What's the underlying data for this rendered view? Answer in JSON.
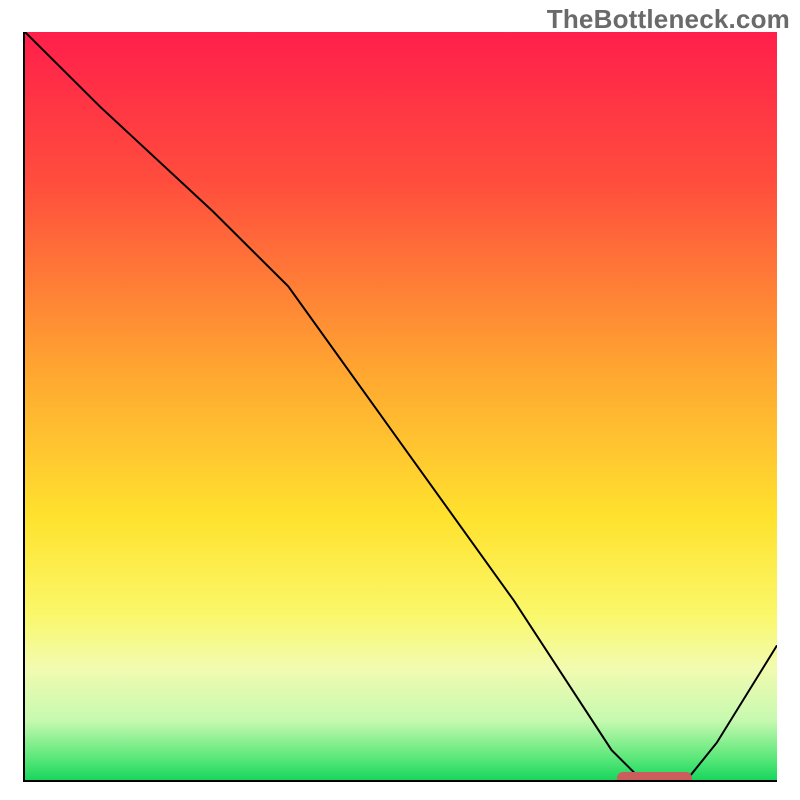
{
  "watermark": "TheBottleneck.com",
  "chart_data": {
    "type": "line",
    "title": "",
    "xlabel": "",
    "ylabel": "",
    "xlim": [
      0,
      100
    ],
    "ylim": [
      0,
      100
    ],
    "x": [
      0,
      10,
      25,
      35,
      50,
      65,
      78,
      82,
      88,
      92,
      100
    ],
    "values": [
      100,
      90,
      76,
      66,
      45,
      24,
      4,
      0,
      0,
      5,
      18
    ],
    "gradient_stops": [
      {
        "offset": 0,
        "color": "#ff1f4b"
      },
      {
        "offset": 20,
        "color": "#ff4d3d"
      },
      {
        "offset": 45,
        "color": "#ffa531"
      },
      {
        "offset": 65,
        "color": "#ffe22e"
      },
      {
        "offset": 78,
        "color": "#faf86b"
      },
      {
        "offset": 85,
        "color": "#f2fbb0"
      },
      {
        "offset": 92,
        "color": "#c7f9b0"
      },
      {
        "offset": 97,
        "color": "#5ce87a"
      },
      {
        "offset": 100,
        "color": "#18d65e"
      }
    ],
    "highlight_range_x": [
      78.5,
      88.5
    ],
    "highlight_y": 0
  }
}
